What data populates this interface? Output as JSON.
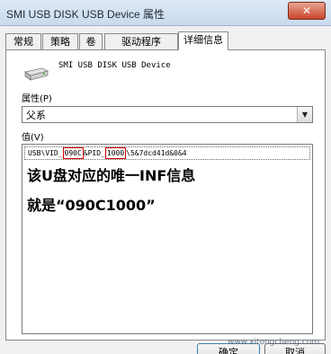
{
  "window": {
    "title": "SMI USB DISK USB Device 属性",
    "close_glyph": "✕"
  },
  "tabs": [
    {
      "label": "常规",
      "active": false
    },
    {
      "label": "策略",
      "active": false
    },
    {
      "label": "卷",
      "active": false
    },
    {
      "label": "驱动程序",
      "active": false
    },
    {
      "label": "详细信息",
      "active": true
    }
  ],
  "device": {
    "icon": "usb-drive-icon",
    "name": "SMI USB DISK USB Device"
  },
  "property": {
    "label": "属性(P)",
    "selected": "父系",
    "arrow_glyph": "▼"
  },
  "value": {
    "label": "值(V)",
    "row": {
      "prefix": "USB\\VID_",
      "vid": "090C",
      "middle": "&PID_",
      "pid": "1000",
      "suffix": "\\5&7dcd41d&0&4"
    },
    "annotation_line1": "该U盘对应的唯一INF信息",
    "annotation_line2": "就是“090C1000”"
  },
  "buttons": {
    "ok": "确定",
    "cancel": "取消"
  },
  "watermark": "www.xitongcheng.com",
  "colors": {
    "highlight_box": "#d40000",
    "titlebar": "#c9daee",
    "close_button": "#c8452b"
  }
}
